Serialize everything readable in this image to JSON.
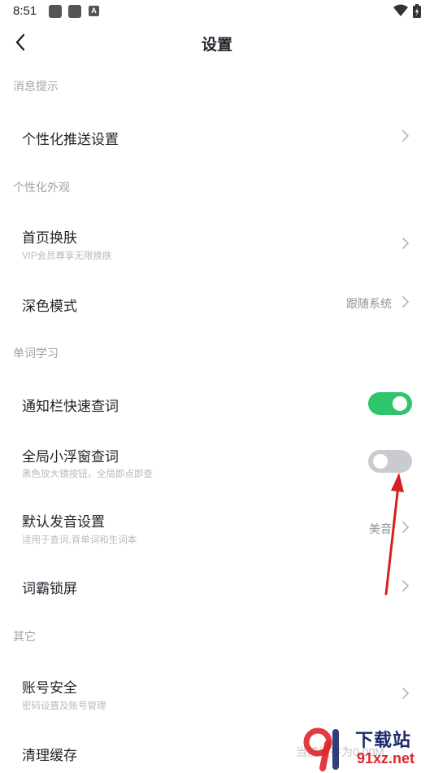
{
  "status_bar": {
    "time": "8:51",
    "icons": [
      "square-icon",
      "square-icon",
      "a-box-icon",
      "wifi-icon",
      "battery-charging-icon"
    ]
  },
  "header": {
    "title": "设置",
    "back_icon": "chevron-left-icon"
  },
  "sections": {
    "notifications": {
      "header": "消息提示",
      "push_settings": {
        "title": "个性化推送设置"
      }
    },
    "appearance": {
      "header": "个性化外观",
      "home_skin": {
        "title": "首页换肤",
        "subtitle": "VIP会员尊享无限换肤"
      },
      "dark_mode": {
        "title": "深色模式",
        "value": "跟随系统"
      }
    },
    "word_learning": {
      "header": "单词学习",
      "notify_lookup": {
        "title": "通知栏快速查词",
        "enabled": true
      },
      "floating_lookup": {
        "title": "全局小浮窗查词",
        "subtitle": "黑色放大镜按钮，全局即点即查",
        "enabled": false
      },
      "pronunciation": {
        "title": "默认发音设置",
        "subtitle": "适用于查词,背单词和生词本",
        "value": "美音"
      },
      "lock_screen": {
        "title": "词霸锁屏"
      }
    },
    "other": {
      "header": "其它",
      "account_security": {
        "title": "账号安全",
        "subtitle": "密码设置及账号管理"
      },
      "clear_cache": {
        "title": "清理缓存",
        "value": "当前缓存为0.00M"
      }
    }
  },
  "colors": {
    "toggle_on": "#2fc56c",
    "toggle_off": "#c9cbd0",
    "annotation_arrow": "#d61f1f"
  },
  "watermark": {
    "title": "下载站",
    "domain": "91xz.net"
  }
}
